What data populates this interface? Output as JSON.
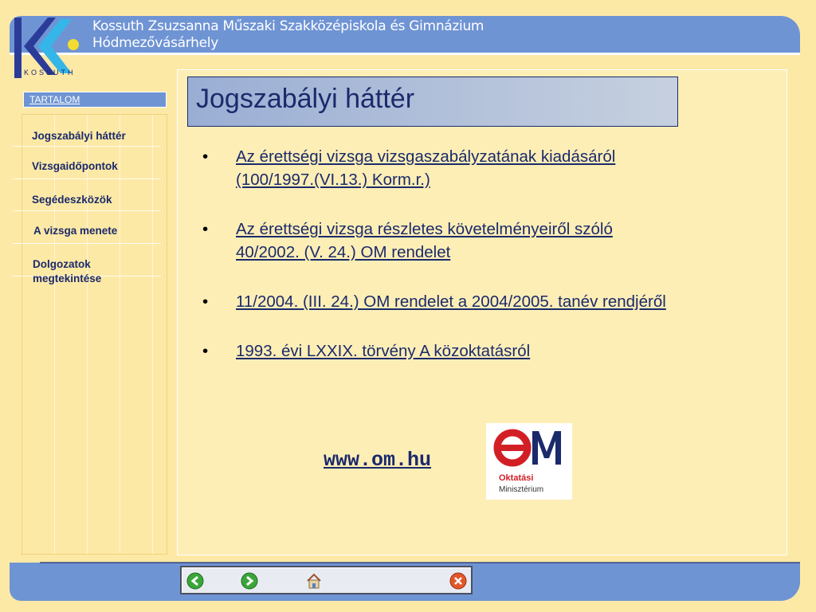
{
  "header": {
    "logo_text": "KOSSUTH",
    "school_name_line1": "Kossuth Zsuzsanna Műszaki Szakközépiskola és Gimnázium",
    "school_name_line2": "Hódmezővásárhely"
  },
  "sidebar": {
    "toc_label": "TARTALOM",
    "items": [
      {
        "label": "Jogszabályi háttér"
      },
      {
        "label": "Vizsgaidőpontok"
      },
      {
        "label": "Segédeszközök"
      },
      {
        "label": "A vizsga menete"
      },
      {
        "label": "Dolgozatok megtekintése"
      }
    ]
  },
  "main": {
    "title": "Jogszabályi háttér",
    "links": [
      {
        "text": "Az érettségi vizsga vizsgaszabályzatának kiadásáról (100/1997.(VI.13.) Korm.r.)"
      },
      {
        "text": "Az érettségi vizsga részletes követelményeiről szóló 40/2002. (V. 24.) OM rendelet"
      },
      {
        "text": "11/2004. (III. 24.) OM rendelet a 2004/2005. tanév rendjéről"
      },
      {
        "text": "1993. évi LXXIX. törvény A közoktatásról"
      }
    ],
    "website": "www.om.hu",
    "om_logo": {
      "letters": "OM",
      "line1": "Oktatási",
      "line2": "Minisztérium"
    }
  },
  "navigation": {
    "buttons": [
      "back-arrow-icon",
      "forward-arrow-icon",
      "home-icon",
      "close-icon"
    ]
  },
  "colors": {
    "background": "#fde9a6",
    "band": "#6f94d4",
    "text_navy": "#1b2a6b",
    "om_red": "#d21f26"
  }
}
